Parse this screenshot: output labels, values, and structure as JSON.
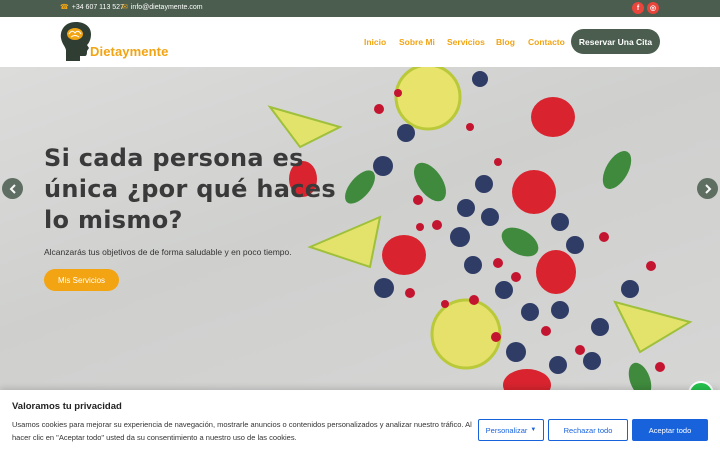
{
  "topbar": {
    "phone": "+34 607 113 527",
    "email": "info@dietaymente.com",
    "phone_icon": "phone-icon",
    "email_icon": "envelope-icon",
    "social": [
      {
        "name": "facebook-icon",
        "glyph": "f"
      },
      {
        "name": "instagram-icon",
        "glyph": "◎"
      }
    ]
  },
  "header": {
    "logo_text": "Dietaymente",
    "nav": [
      "Inicio",
      "Sobre Mi",
      "Servicios",
      "Blog",
      "Contacto"
    ],
    "cta": "Reservar Una Cita"
  },
  "hero": {
    "title": "Si cada persona es única ¿por qué haces lo mismo?",
    "subtitle": "Alcanzarás tus objetivos de de forma saludable y en poco tiempo.",
    "button": "Mis Servicios"
  },
  "cookie": {
    "title": "Valoramos tu privacidad",
    "text": "Usamos cookies para mejorar su experiencia de navegación, mostrarle anuncios o contenidos personalizados y analizar nuestro tráfico. Al hacer clic en \"Aceptar todo\" usted da su consentimiento a nuestro uso de las cookies.",
    "customize": "Personalizar",
    "reject": "Rechazar todo",
    "accept": "Aceptar todo"
  },
  "colors": {
    "brand_green": "#4a5d4e",
    "accent_orange": "#f2a413",
    "cookie_blue": "#1863dc"
  }
}
